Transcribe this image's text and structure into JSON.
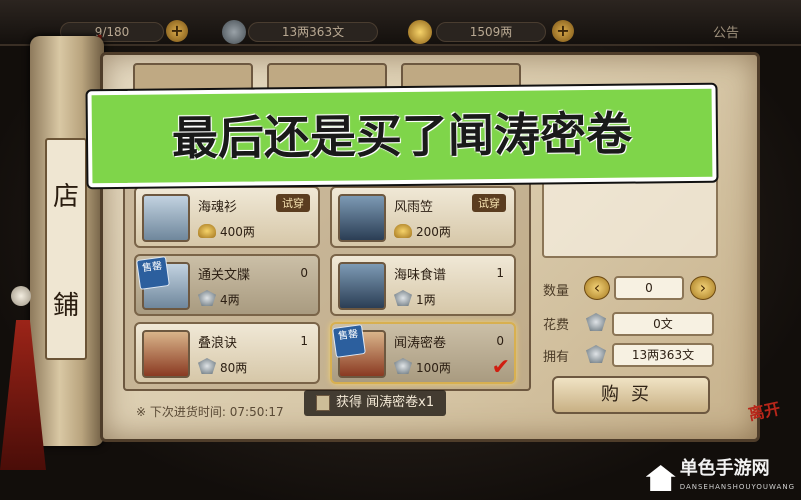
{
  "topbar": {
    "stamina": "9/180",
    "money": "13两363文",
    "gold": "1509两",
    "notice": "公告"
  },
  "shop": {
    "label_chars": [
      "店",
      "鋪"
    ],
    "items": [
      {
        "name": "海魂衫",
        "price": "400两",
        "currency": "gold",
        "try_label": "试穿",
        "sold": false,
        "qty": ""
      },
      {
        "name": "风雨笠",
        "price": "200两",
        "currency": "gold",
        "try_label": "试穿",
        "sold": false,
        "qty": ""
      },
      {
        "name": "通关文牒",
        "price": "4两",
        "currency": "silver",
        "sold": true,
        "sold_label": "售罄",
        "qty": "0"
      },
      {
        "name": "海味食谱",
        "price": "1两",
        "currency": "silver",
        "sold": false,
        "qty": "1"
      },
      {
        "name": "叠浪诀",
        "price": "80两",
        "currency": "silver",
        "sold": false,
        "qty": "1"
      },
      {
        "name": "闻涛密卷",
        "price": "100两",
        "currency": "silver",
        "sold": true,
        "sold_label": "售罄",
        "qty": "0",
        "selected": true
      }
    ],
    "restock_label": "※ 下次进货时间:",
    "restock_time": "07:50:17"
  },
  "panel": {
    "qty_label": "数量",
    "qty_value": "0",
    "cost_label": "花费",
    "cost_value": "0文",
    "own_label": "拥有",
    "own_value": "13两363文",
    "buy_label": "购买"
  },
  "toast": "获得 闻涛密卷x1",
  "depart_label": "离开",
  "banner": "最后还是买了闻涛密卷",
  "watermark": {
    "name": "单色手游网",
    "sub": "DANSEHANSHOUYOUWANG"
  }
}
